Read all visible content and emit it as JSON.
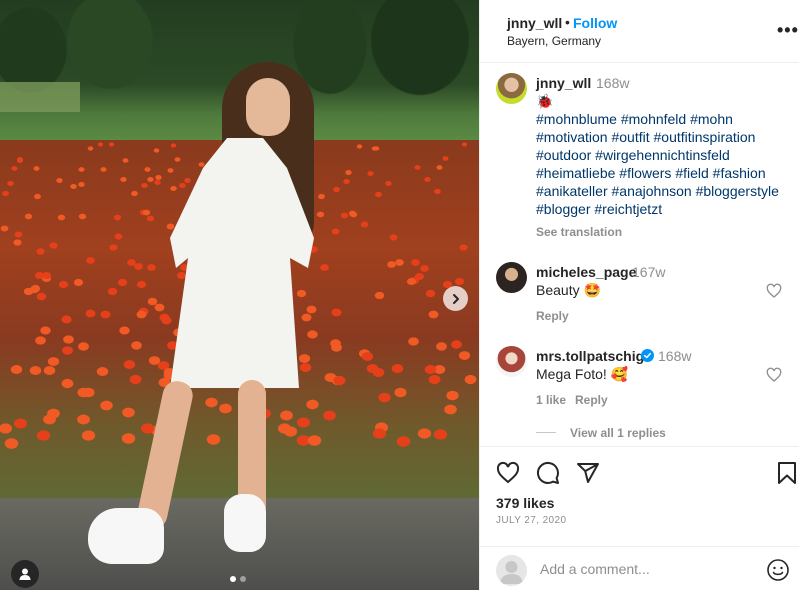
{
  "post": {
    "username": "jnny_wll",
    "separator": "•",
    "follow_label": "Follow",
    "location": "Bayern, Germany",
    "more_label": "•••"
  },
  "photo": {
    "carousel_count": 2,
    "carousel_index": 1,
    "next_icon": "chevron-right-icon",
    "tag_icon": "user-tag-icon"
  },
  "caption": {
    "username": "jnny_wll",
    "time": "168w",
    "emoji": "🐞",
    "hashtags": [
      "#mohnblume",
      "#mohnfeld",
      "#mohn",
      "#motivation",
      "#outfit",
      "#outfitinspiration",
      "#outdoor",
      "#wirgehennichtinsfeld",
      "#heimatliebe",
      "#flowers",
      "#field",
      "#fashion",
      "#anikateller",
      "#anajohnson",
      "#bloggerstyle",
      "#blogger",
      "#reichtjetzt"
    ],
    "see_translation": "See translation"
  },
  "comments": [
    {
      "username": "micheles_page",
      "time": "167w",
      "text": "Beauty 🤩",
      "reply_label": "Reply",
      "verified": false
    },
    {
      "username": "mrs.tollpatschig",
      "time": "168w",
      "text": "Mega Foto! 🥰",
      "likes_label": "1 like",
      "reply_label": "Reply",
      "verified": true,
      "view_replies": "View all 1 replies"
    }
  ],
  "actions": {
    "likes": "379 likes",
    "date": "JULY 27, 2020",
    "icons": [
      "heart-icon",
      "comment-icon",
      "share-icon",
      "bookmark-icon"
    ]
  },
  "comment_box": {
    "placeholder": "Add a comment...",
    "emoji_icon": "smiley-icon"
  },
  "colors": {
    "link": "#0095f6",
    "hashtag": "#00376b",
    "muted": "#8e8e8e",
    "text": "#262626"
  }
}
